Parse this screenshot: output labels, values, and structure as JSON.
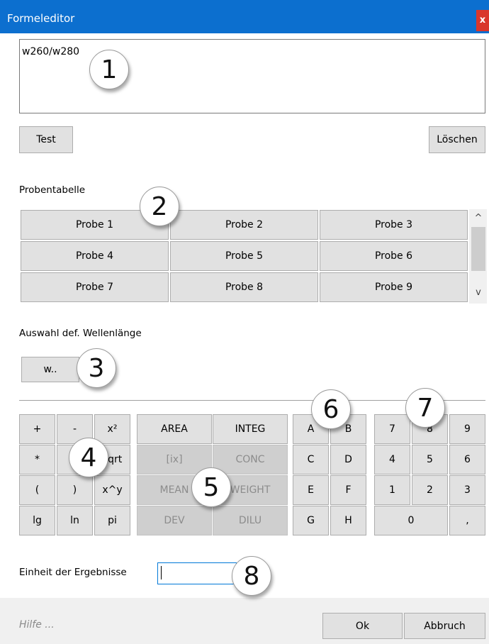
{
  "window": {
    "title": "Formeleditor",
    "close_glyph": "x"
  },
  "formula": {
    "value": "w260/w280"
  },
  "buttons": {
    "test": "Test",
    "clear": "Löschen",
    "wavelength": "w..",
    "ok": "Ok",
    "cancel": "Abbruch"
  },
  "sample_table": {
    "label": "Probentabelle",
    "samples": [
      "Probe 1",
      "Probe 2",
      "Probe 3",
      "Probe 4",
      "Probe 5",
      "Probe 6",
      "Probe 7",
      "Probe 8",
      "Probe 9"
    ],
    "scroll_up": "^",
    "scroll_down": "v"
  },
  "wavelength_label": "Auswahl def. Wellenlänge",
  "operators": [
    "+",
    "-",
    "x²",
    "*",
    "/",
    "sqrt",
    "(",
    ")",
    "x^y",
    "lg",
    "ln",
    "pi"
  ],
  "functions": [
    {
      "label": "AREA",
      "enabled": true
    },
    {
      "label": "INTEG",
      "enabled": true
    },
    {
      "label": "[ix]",
      "enabled": false
    },
    {
      "label": "CONC",
      "enabled": false
    },
    {
      "label": "MEAN",
      "enabled": false
    },
    {
      "label": "WEIGHT",
      "enabled": false
    },
    {
      "label": "DEV",
      "enabled": false
    },
    {
      "label": "DILU",
      "enabled": false
    }
  ],
  "variables": [
    "A",
    "B",
    "C",
    "D",
    "E",
    "F",
    "G",
    "H"
  ],
  "numpad": [
    "7",
    "8",
    "9",
    "4",
    "5",
    "6",
    "1",
    "2",
    "3",
    "0",
    ","
  ],
  "unit": {
    "label": "Einheit der Ergebnisse",
    "value": ""
  },
  "footer": {
    "help": "Hilfe ..."
  },
  "callouts": [
    "1",
    "2",
    "3",
    "4",
    "5",
    "6",
    "7",
    "8"
  ]
}
